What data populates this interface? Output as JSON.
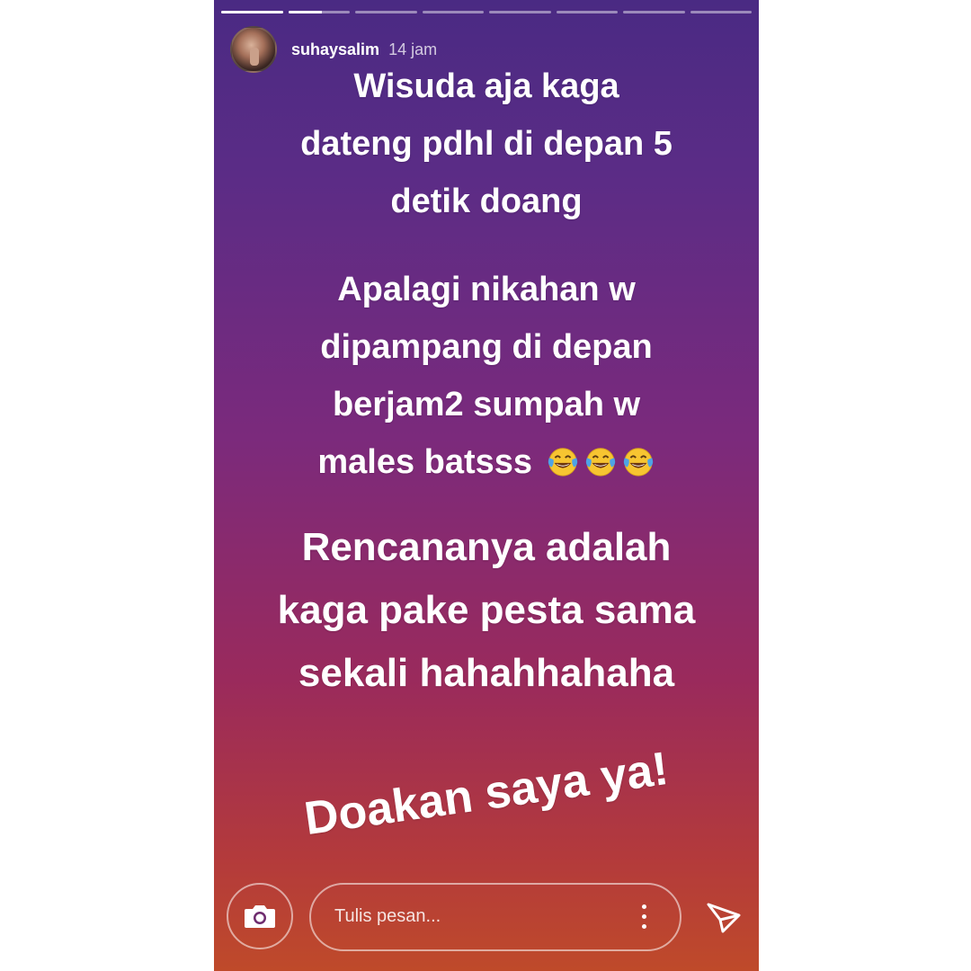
{
  "story": {
    "progress": {
      "segments": 8,
      "active_index": 1,
      "active_fraction": 0.55
    },
    "header": {
      "username": "suhaysalim",
      "time": "14 jam"
    },
    "text_blocks": {
      "block1": [
        "Wisuda aja kaga",
        "dateng pdhl di depan 5",
        "detik doang"
      ],
      "block2": [
        "Apalagi nikahan w",
        "dipampang di depan",
        "berjam2 sumpah w",
        "males batsss"
      ],
      "block3": [
        "Rencananya adalah",
        "kaga pake pesta sama",
        "sekali hahahhahaha"
      ],
      "block4": "Doakan saya ya!"
    },
    "emoji": {
      "name": "face-with-tears-of-joy",
      "count": 3
    }
  },
  "composer": {
    "placeholder": "Tulis pesan...",
    "camera_icon": "camera-icon",
    "more_icon": "more-vertical-icon",
    "send_icon": "send-icon"
  },
  "colors": {
    "gradient_top": "#4a2a83",
    "gradient_mid": "#7b2a7c",
    "gradient_bottom": "#bf4a2a",
    "text": "#ffffff"
  }
}
